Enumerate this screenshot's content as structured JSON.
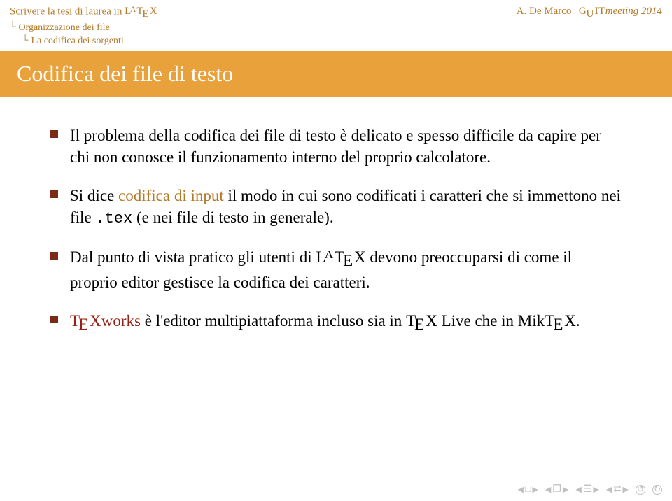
{
  "header": {
    "doc_title": "Scrivere la tesi di laurea in LᴬTᴇX",
    "breadcrumb1": "Organizzazione dei file",
    "breadcrumb2": "La codifica dei sorgenti",
    "author": "A. De Marco",
    "conf_prefix": "G",
    "conf_u": "U",
    "conf_it": "IT",
    "conf_meeting": "meeting 2014"
  },
  "title": "Codifica dei file di testo",
  "bullets": {
    "b1_a": "Il problema della codifica dei file di testo è delicato e spesso difficile da capire per chi non conosce il funzionamento interno del proprio calcolatore.",
    "b2_a": "Si dice ",
    "b2_accent": "codifica di input",
    "b2_b": " il modo in cui sono codificati i caratteri che si immettono nei file ",
    "b2_tt": ".tex",
    "b2_c": " (e nei file di testo in generale).",
    "b3_a": "Dal punto di vista pratico gli utenti di ",
    "b3_b": " devono preoccuparsi di come il proprio editor gestisce la codifica dei caratteri.",
    "b4_red_a": "T",
    "b4_red_e": "E",
    "b4_red_b": "Xworks",
    "b4_a": " è l'editor multipiattaforma incluso sia in ",
    "b4_tex_a": "T",
    "b4_tex_e": "E",
    "b4_tex_b": "X",
    "b4_b": " Live che in Mik",
    "b4_c": "."
  },
  "nav": {
    "sq": "□",
    "frame": "❐",
    "doc": "☰",
    "dbl": "⮂"
  }
}
